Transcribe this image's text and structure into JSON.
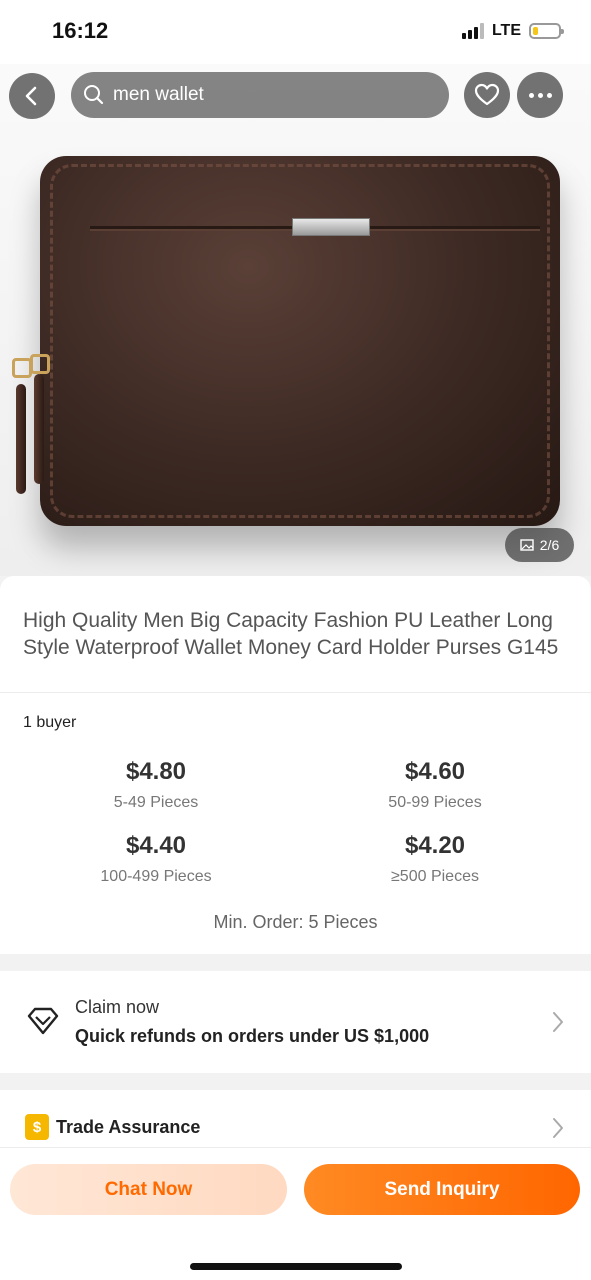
{
  "status_bar": {
    "time": "16:12",
    "network": "LTE"
  },
  "top_bar": {
    "search_text": "men wallet",
    "icons": {
      "back": "chevron-left-icon",
      "search": "search-icon",
      "favorite": "heart-icon",
      "more": "more-dots-icon"
    }
  },
  "gallery": {
    "counter": "2/6",
    "counter_icon": "image-icon"
  },
  "product": {
    "title": "High Quality Men Big Capacity Fashion PU Leather Long Style Waterproof Wallet Money Card Holder Purses G145",
    "buyers": "1 buyer",
    "price_tiers": [
      {
        "price": "$4.80",
        "quantity": "5-49 Pieces"
      },
      {
        "price": "$4.60",
        "quantity": "50-99 Pieces"
      },
      {
        "price": "$4.40",
        "quantity": "100-499 Pieces"
      },
      {
        "price": "$4.20",
        "quantity": "≥500 Pieces"
      }
    ],
    "min_order": "Min. Order: 5 Pieces"
  },
  "claim": {
    "line1": "Claim now",
    "line2": "Quick refunds on orders under US $1,000",
    "icon": "diamond-icon"
  },
  "trade_assurance": {
    "label": "Trade Assurance",
    "badge": "$"
  },
  "actions": {
    "chat": "Chat Now",
    "inquiry": "Send Inquiry"
  },
  "colors": {
    "accent": "#ff6a00",
    "chat_bg": "#ffe2cf",
    "badge": "#f5b700"
  }
}
